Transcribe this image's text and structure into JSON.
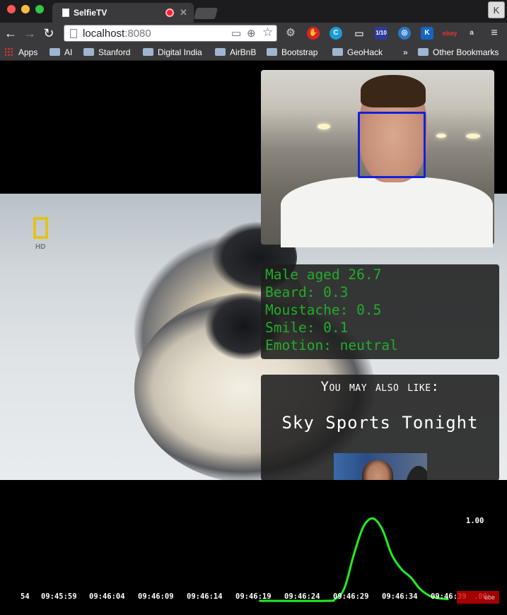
{
  "browser": {
    "tab_title": "SelfieTV",
    "url_host": "localhost",
    "url_port": ":8080",
    "profile_initial": "K",
    "extensions": [
      "stop-icon",
      "c-icon",
      "cast-icon",
      "calendar-icon",
      "globe-icon",
      "k-icon",
      "ebay-icon",
      "amazon-icon",
      "menu-icon"
    ],
    "ext_badges": {
      "stop": "1",
      "calendar": "1/10",
      "ebay": "ebay",
      "kicon": "K"
    }
  },
  "bookmarks": {
    "apps": "Apps",
    "items": [
      "AI",
      "Stanford",
      "Digital India",
      "AirBnB",
      "Bootstrap",
      "GeoHack"
    ],
    "overflow": "»",
    "other": "Other Bookmarks"
  },
  "video": {
    "channel_badge": "HD"
  },
  "attributes": {
    "gender_age": "Male aged 26.7",
    "beard": "Beard: 0.3",
    "moustache": "Moustache: 0.5",
    "smile": "Smile: 0.1",
    "emotion": "Emotion: neutral"
  },
  "recommendation": {
    "heading": "You may also like:",
    "title": "Sky Sports Tonight"
  },
  "chart_data": {
    "type": "line",
    "y_max_label": "1.00",
    "ylim": [
      0,
      1.0
    ],
    "x_ticks": [
      "54",
      "09:45:59",
      "09:46:04",
      "09:46:09",
      "09:46:14",
      "09:46:19",
      "09:46:24",
      "09:46:29",
      "09:46:34",
      "09:46:39",
      ".00"
    ],
    "series": [
      {
        "color": "#22ee22",
        "x": [
          "09:46:20",
          "09:46:27",
          "09:46:28",
          "09:46:29",
          "09:46:30",
          "09:46:31",
          "09:46:32",
          "09:46:33",
          "09:46:34",
          "09:46:35",
          "09:46:36",
          "09:46:37",
          "09:46:38",
          "09:46:39",
          "09:46:40"
        ],
        "values": [
          0.0,
          0.0,
          0.02,
          0.15,
          0.55,
          0.88,
          0.98,
          0.85,
          0.55,
          0.38,
          0.28,
          0.14,
          0.06,
          0.03,
          0.02
        ]
      }
    ]
  },
  "colors": {
    "attr_text": "#22ad2a",
    "face_box": "#1222d8",
    "line": "#22ee22"
  }
}
